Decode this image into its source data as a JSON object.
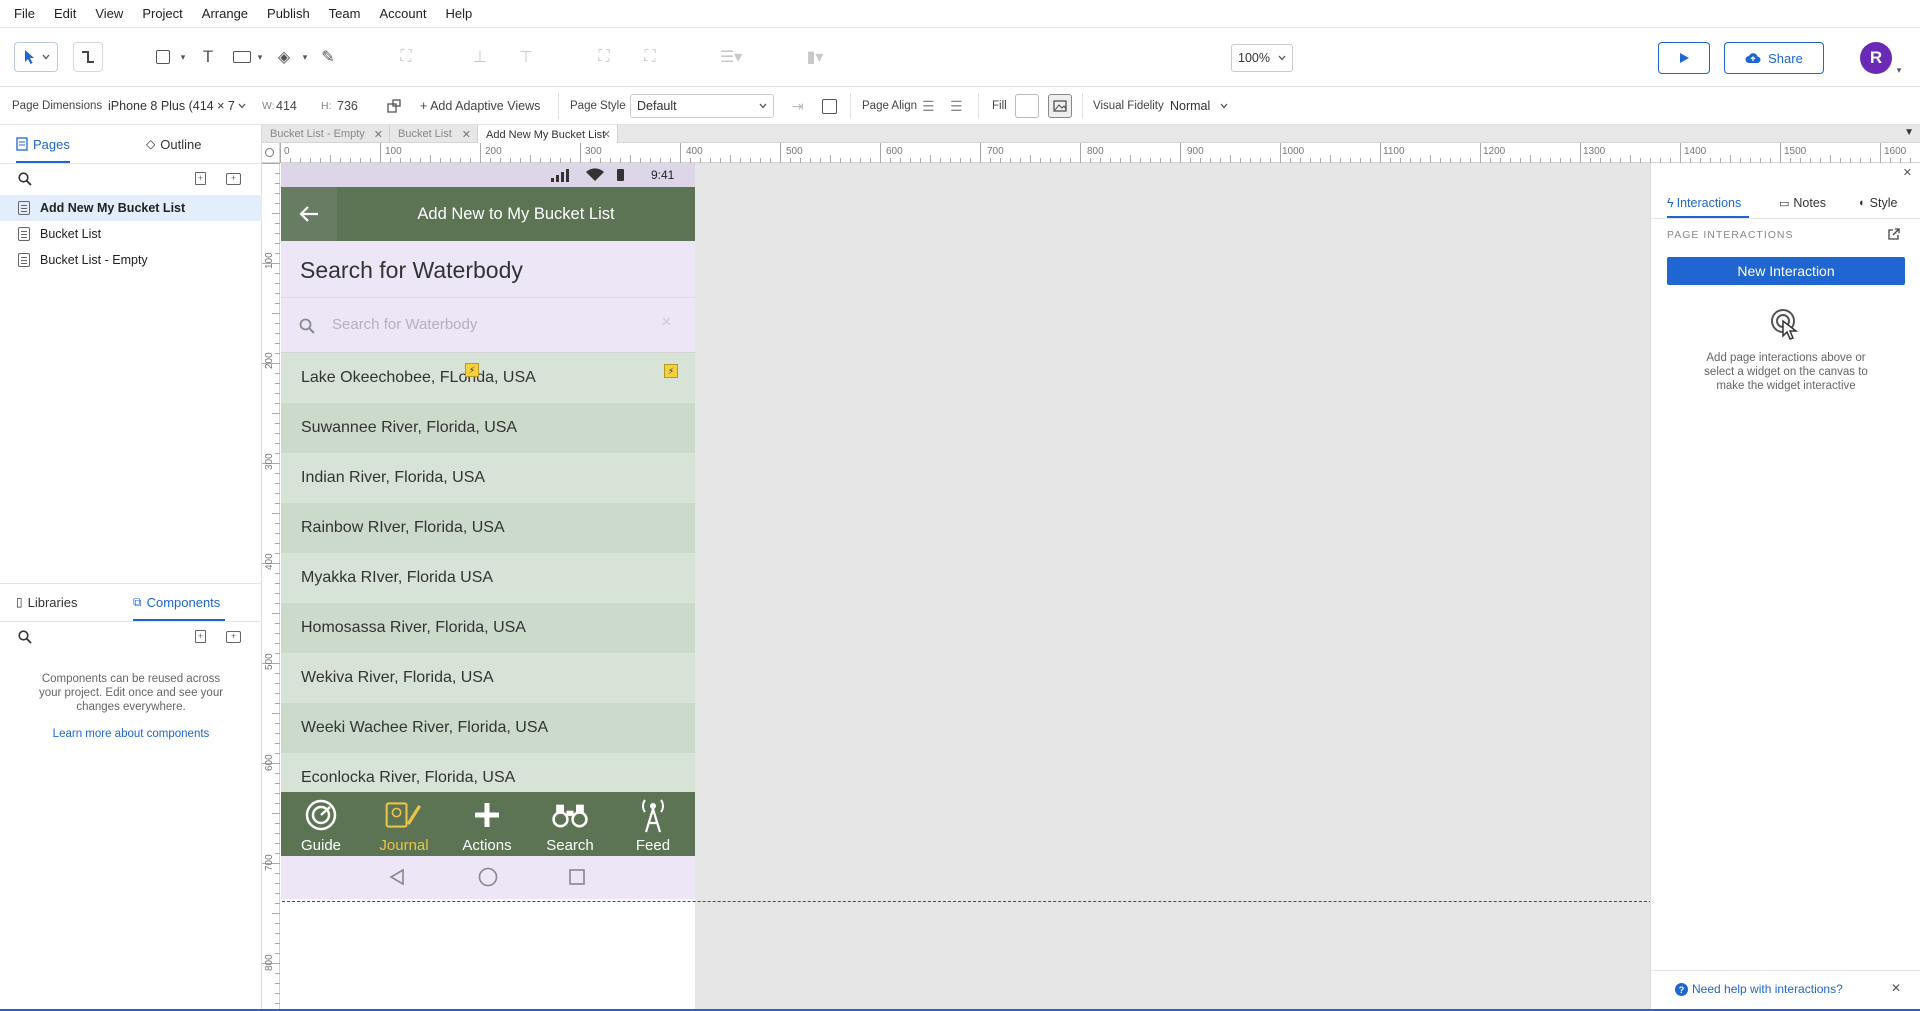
{
  "menu": [
    "File",
    "Edit",
    "View",
    "Project",
    "Arrange",
    "Publish",
    "Team",
    "Account",
    "Help"
  ],
  "toolbar": {
    "zoom": "100%",
    "share_label": "Share",
    "avatar_initial": "R"
  },
  "propbar": {
    "page_dimensions_label": "Page Dimensions",
    "device": "iPhone 8 Plus  (414 × 7",
    "w_label": "W:",
    "w_value": "414",
    "h_label": "H:",
    "h_value": "736",
    "adaptive_label": "+ Add Adaptive Views",
    "page_style_label": "Page Style",
    "page_style_value": "Default",
    "page_align_label": "Page Align",
    "fill_label": "Fill",
    "visual_fidelity_label": "Visual Fidelity",
    "visual_fidelity_value": "Normal"
  },
  "left_panel": {
    "tabs": [
      "Pages",
      "Outline"
    ],
    "pages": [
      "Add New My Bucket List",
      "Bucket List",
      "Bucket List - Empty"
    ],
    "bottom_tabs": [
      "Libraries",
      "Components"
    ],
    "components_text": "Components can be reused across your project. Edit once and see your changes everywhere.",
    "components_link": "Learn more about components"
  },
  "doc_tabs": [
    "Bucket List - Empty",
    "Bucket List",
    "Add New My Bucket List"
  ],
  "ruler": {
    "h": [
      "0",
      "100",
      "200",
      "300",
      "400",
      "500",
      "600",
      "700",
      "800",
      "900",
      "1000",
      "1100",
      "1200",
      "1300",
      "1400",
      "1500",
      "1600"
    ],
    "v": [
      "100",
      "200",
      "300",
      "400",
      "500",
      "600",
      "700",
      "800"
    ]
  },
  "phone": {
    "time": "9:41",
    "header_title": "Add New to My Bucket List",
    "section_title": "Search for Waterbody",
    "search_placeholder": "Search for Waterbody",
    "rows": [
      "Lake Okeechobee, FLorida, USA",
      "Suwannee River, Florida, USA",
      "Indian River, Florida, USA",
      "Rainbow RIver, Florida, USA",
      "Myakka RIver, Florida USA",
      "Homosassa River, Florida, USA",
      "Wekiva River, Florida, USA",
      "Weeki Wachee River, Florida, USA",
      "Econlocka River, Florida, USA"
    ],
    "nav": [
      "Guide",
      "Journal",
      "Actions",
      "Search",
      "Feed"
    ],
    "colors": {
      "header": "#5c7354",
      "accent": "#e8c44a",
      "lavender": "#ece6f7"
    }
  },
  "right_panel": {
    "tabs": [
      "Interactions",
      "Notes",
      "Style"
    ],
    "section_label": "PAGE INTERACTIONS",
    "new_interaction_label": "New Interaction",
    "hint": "Add page interactions above or select a widget on the canvas to make the widget interactive",
    "help_link": "Need help with interactions?"
  },
  "colors": {
    "accent_blue": "#1f66d1"
  }
}
